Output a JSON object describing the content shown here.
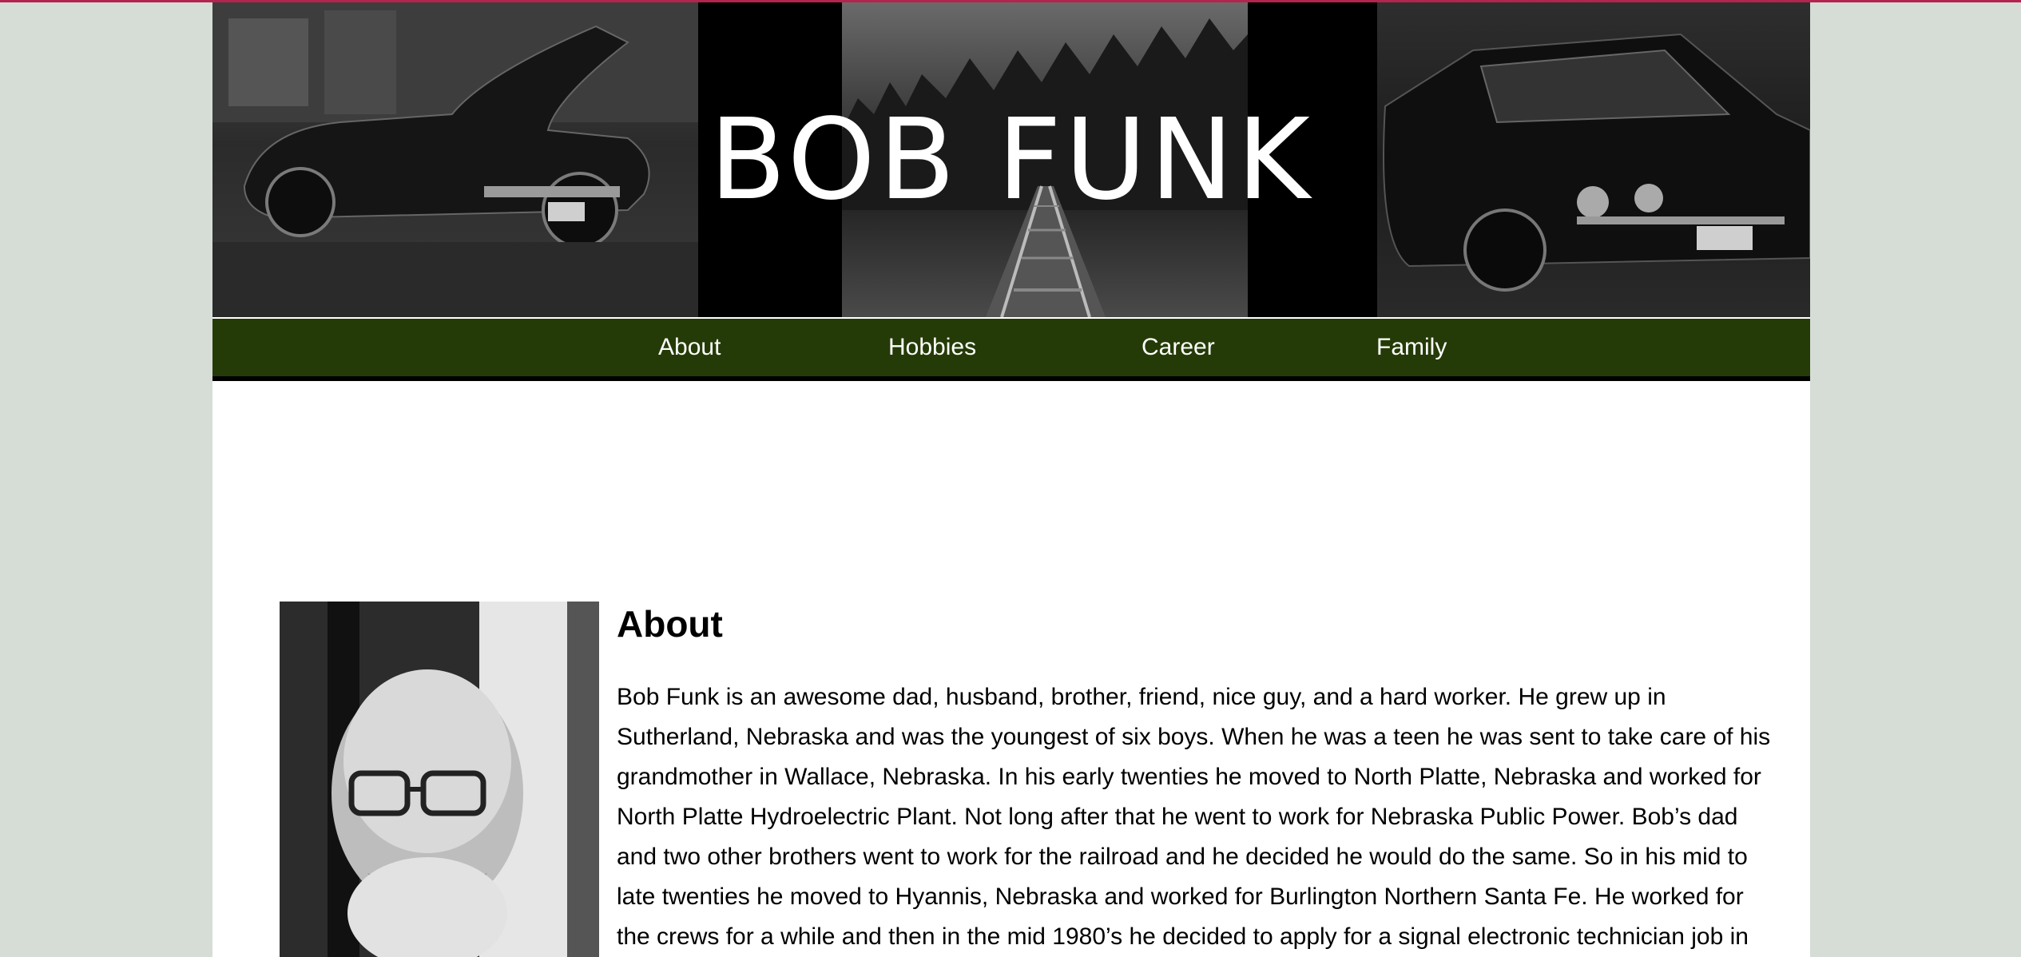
{
  "header": {
    "site_title": "BOB FUNK",
    "banner_images": [
      "vintage-car-left",
      "railroad-tracks",
      "vintage-car-right"
    ]
  },
  "nav": {
    "items": [
      {
        "label": "About"
      },
      {
        "label": "Hobbies"
      },
      {
        "label": "Career"
      },
      {
        "label": "Family"
      }
    ]
  },
  "about": {
    "heading": "About",
    "photo": "portrait-photo",
    "paragraph": "Bob Funk is an awesome dad, husband, brother, friend, nice guy, and a hard worker. He grew up in Sutherland, Nebraska and was the youngest of six boys. When he was a teen he was sent to take care of his grandmother in Wallace, Nebraska. In his early twenties he moved to North Platte, Nebraska and worked for North Platte Hydroelectric Plant. Not long after that he went to work for Nebraska Public Power. Bob’s dad and two other brothers went to work for the railroad and he decided he would do the same. So in his mid to late twenties he moved to Hyannis, Nebraska and worked for Burlington Northern Santa Fe. He worked for the crews for a while and then in the mid 1980’s he decided to apply for a signal electronic technician job in"
  },
  "colors": {
    "page_background": "#d5ddd6",
    "nav_background": "#253b07",
    "top_accent": "#b5234f",
    "content_background": "#ffffff"
  }
}
